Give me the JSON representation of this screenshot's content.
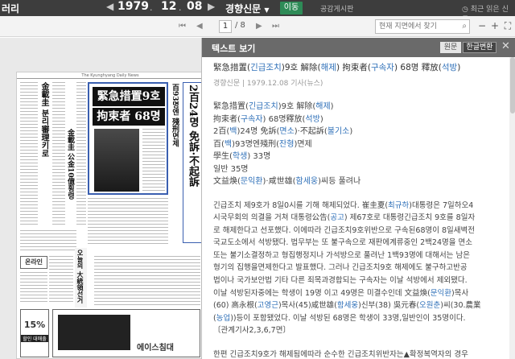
{
  "topbar": {
    "brand": "러리",
    "year": "1979",
    "month": "12",
    "day": "08",
    "paper": "경향신문",
    "move_label": "이동",
    "notice_label": "공감게시판",
    "recent_label": "최근 읽은 신문"
  },
  "toolbar": {
    "page_current": "1",
    "page_total": "/ 8",
    "search_placeholder": "현재 지면에서 찾기"
  },
  "newspaper": {
    "masthead": "The Kyunghyang Daily News",
    "headline_1": "緊急措置9호 解除",
    "headline_2": "拘束者 68명釋放",
    "side_head_1": "百93명엔 殘刑면제",
    "side_head_2": "2百24명 免訴·不起訴",
    "left_head_1": "金載圭 분리審理키로",
    "left_head_2": "金載圭 公金10億횡령",
    "left_head_3": "오늘의 大統領선거",
    "ad_1_text": "온라인",
    "ad_2_text": "15%",
    "ad_2_sub": "할인 대매출",
    "ad_3_text": "에이스침대"
  },
  "panel": {
    "title": "텍스트 보기",
    "original_label": "원문",
    "hangul_label": "한글변환",
    "close_label": "✕"
  },
  "article": {
    "title_segments": [
      {
        "t": "緊急措置(",
        "h": false
      },
      {
        "t": "긴급조치",
        "h": true
      },
      {
        "t": ")9호 解除(",
        "h": false
      },
      {
        "t": "해제",
        "h": true
      },
      {
        "t": ") 拘束者(",
        "h": false
      },
      {
        "t": "구속자",
        "h": true
      },
      {
        "t": ") 68명 釋放(",
        "h": false
      },
      {
        "t": "석방",
        "h": true
      },
      {
        "t": ")",
        "h": false
      }
    ],
    "meta": "경향신문 | 1979.12.08 기사(뉴스)",
    "lines": [
      [
        {
          "t": "緊急措置(",
          "h": false
        },
        {
          "t": "긴급조치",
          "h": true
        },
        {
          "t": ")9호 解除(",
          "h": false
        },
        {
          "t": "해제",
          "h": true
        },
        {
          "t": ")",
          "h": false
        }
      ],
      [
        {
          "t": "拘束者(",
          "h": false
        },
        {
          "t": "구속자",
          "h": true
        },
        {
          "t": ") 68명釋放(",
          "h": false
        },
        {
          "t": "석방",
          "h": true
        },
        {
          "t": ")",
          "h": false
        }
      ],
      [
        {
          "t": "2百(",
          "h": false
        },
        {
          "t": "백",
          "h": true
        },
        {
          "t": ")24명 免訴(",
          "h": false
        },
        {
          "t": "면소",
          "h": true
        },
        {
          "t": ")·不起訴(",
          "h": false
        },
        {
          "t": "불기소",
          "h": true
        },
        {
          "t": ")",
          "h": false
        }
      ],
      [
        {
          "t": "百(",
          "h": false
        },
        {
          "t": "백",
          "h": true
        },
        {
          "t": ")93명엔殘刑(",
          "h": false
        },
        {
          "t": "잔형",
          "h": true
        },
        {
          "t": ")면제",
          "h": false
        }
      ],
      [
        {
          "t": "學生(",
          "h": false
        },
        {
          "t": "학생",
          "h": true
        },
        {
          "t": ") 33명",
          "h": false
        }
      ],
      [
        {
          "t": "일반 35명",
          "h": false
        }
      ],
      [
        {
          "t": "文益煥(",
          "h": false
        },
        {
          "t": "문익환",
          "h": true
        },
        {
          "t": ")·咸世雄(",
          "h": false
        },
        {
          "t": "함세웅",
          "h": true
        },
        {
          "t": ")씨등 풀려나",
          "h": false
        }
      ]
    ],
    "para_1": [
      [
        {
          "t": "긴급조치 제9호가 8일0시를 기해 해제되었다. 崔圭夏(",
          "h": false
        },
        {
          "t": "최규하",
          "h": true
        },
        {
          "t": ")대통령은 7일하오4",
          "h": false
        }
      ],
      [
        {
          "t": "시국무회의 의결을 거쳐 대통령公告(",
          "h": false
        },
        {
          "t": "공고",
          "h": true
        },
        {
          "t": ") 제67호로 대통령긴급조치 9호를 8일자",
          "h": false
        }
      ],
      [
        {
          "t": "로 해제한다고 선포했다. 이에따라 긴급조치9호위반으로 구속된68명이 8일새벽전",
          "h": false
        }
      ],
      [
        {
          "t": "국교도소에서 석방됐다. 법무부는 또 불구속으로 재판에계류중인 2백24명을 면소",
          "h": false
        }
      ],
      [
        {
          "t": "또는 불기소결정하고 형집행정지나 가석방으로 풀려난 1백93명에 대해서는 남은",
          "h": false
        }
      ],
      [
        {
          "t": "형기의 집행을면제한다고 발표했다. 그러나 긴급조치9호 해제에도 불구하고반공",
          "h": false
        }
      ],
      [
        {
          "t": "법이나 국가보안법 기타 다른 죄목과경합되는 구속자는 이날 석방에서 제외됐다.",
          "h": false
        }
      ],
      [
        {
          "t": "이날 석방된자중에는 학생이 19명 이고 49명은 미결수인데 文益煥(",
          "h": false
        },
        {
          "t": "문익환",
          "h": true
        },
        {
          "t": ")목사",
          "h": false
        }
      ],
      [
        {
          "t": "(60) 高永根(",
          "h": false
        },
        {
          "t": "고영근",
          "h": true
        },
        {
          "t": ")목사(45)咸世雄(",
          "h": false
        },
        {
          "t": "함세웅",
          "h": true
        },
        {
          "t": ")신부(38) 吳元春(",
          "h": false
        },
        {
          "t": "오원춘",
          "h": true
        },
        {
          "t": ")씨(30.農業",
          "h": false
        }
      ],
      [
        {
          "t": "(",
          "h": false
        },
        {
          "t": "농업",
          "h": true
        },
        {
          "t": "))등이 포함됐었다. 이날 석방된 68명은 학생이 33명,일반인이 35명이다.",
          "h": false
        }
      ],
      [
        {
          "t": "〔관계기사2,3,6,7면〕",
          "h": false
        }
      ]
    ],
    "para_2": [
      [
        {
          "t": "한편 긴급조치9호가 해제됨에따라 순수한 긴급조치위반자는▲확정복역자의 경우",
          "h": false
        }
      ],
      [
        {
          "t": "잔형집행이 면제되고 ▲재판중인자는 처벌법규가 없으므로 면소판결을받으며 ▲",
          "h": false
        }
      ]
    ]
  },
  "colors": {
    "topbar_bg": "#3d3d3d",
    "move_button": "#2e8b57",
    "hanja_reading": "#2d6fb8",
    "panel_header": "#6a6a6a",
    "headline_frame": "#3a5fb0"
  }
}
